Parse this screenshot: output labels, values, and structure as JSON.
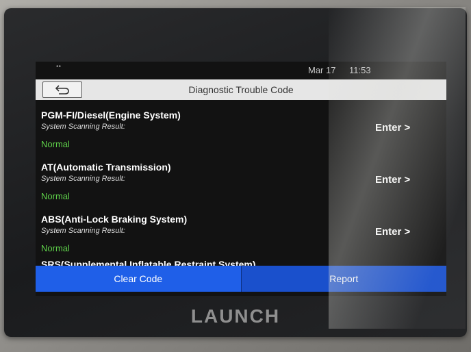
{
  "status_bar": {
    "date": "Mar 17",
    "time": "11:53"
  },
  "header": {
    "title": "Diagnostic Trouble Code",
    "back_icon": "back-arrow-icon"
  },
  "systems": [
    {
      "name": "PGM-FI/Diesel(Engine System)",
      "result_label": "System Scanning Result:",
      "status": "Normal",
      "enter_label": "Enter >"
    },
    {
      "name": "AT(Automatic Transmission)",
      "result_label": "System Scanning Result:",
      "status": "Normal",
      "enter_label": "Enter >"
    },
    {
      "name": "ABS(Anti-Lock Braking System)",
      "result_label": "System Scanning Result:",
      "status": "Normal",
      "enter_label": "Enter >"
    }
  ],
  "partial_row": "SRS(Supplemental Inflatable Restraint System)",
  "footer": {
    "clear_label": "Clear Code",
    "report_label": "Report"
  },
  "brand": "LAUNCH",
  "colors": {
    "accent_blue": "#1f5fe8",
    "normal_green": "#5fd24a",
    "title_bar": "#e6e6e6"
  }
}
